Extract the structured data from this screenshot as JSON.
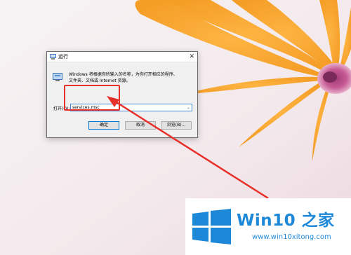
{
  "run_dialog": {
    "title": "运行",
    "description_line1": "Windows 将根据你所输入的名称，为你打开相应的程序、",
    "description_line2": "文件夹、文档或 Internet 资源。",
    "open_label": "打开(O):",
    "input_value": "services.msc",
    "buttons": {
      "ok": "确定",
      "cancel": "取消",
      "browse": "浏览(B)..."
    }
  },
  "watermark": {
    "title": "Win10 之家",
    "url": "www.win10xitong.com"
  },
  "colors": {
    "highlight": "#e8302b",
    "brand": "#1e88d8"
  },
  "icons": {
    "title_icon": "run-icon",
    "app_icon": "run-app-icon",
    "close_icon": "close-icon",
    "dropdown_icon": "chevron-down-icon",
    "logo_icon": "windows-logo-icon"
  }
}
